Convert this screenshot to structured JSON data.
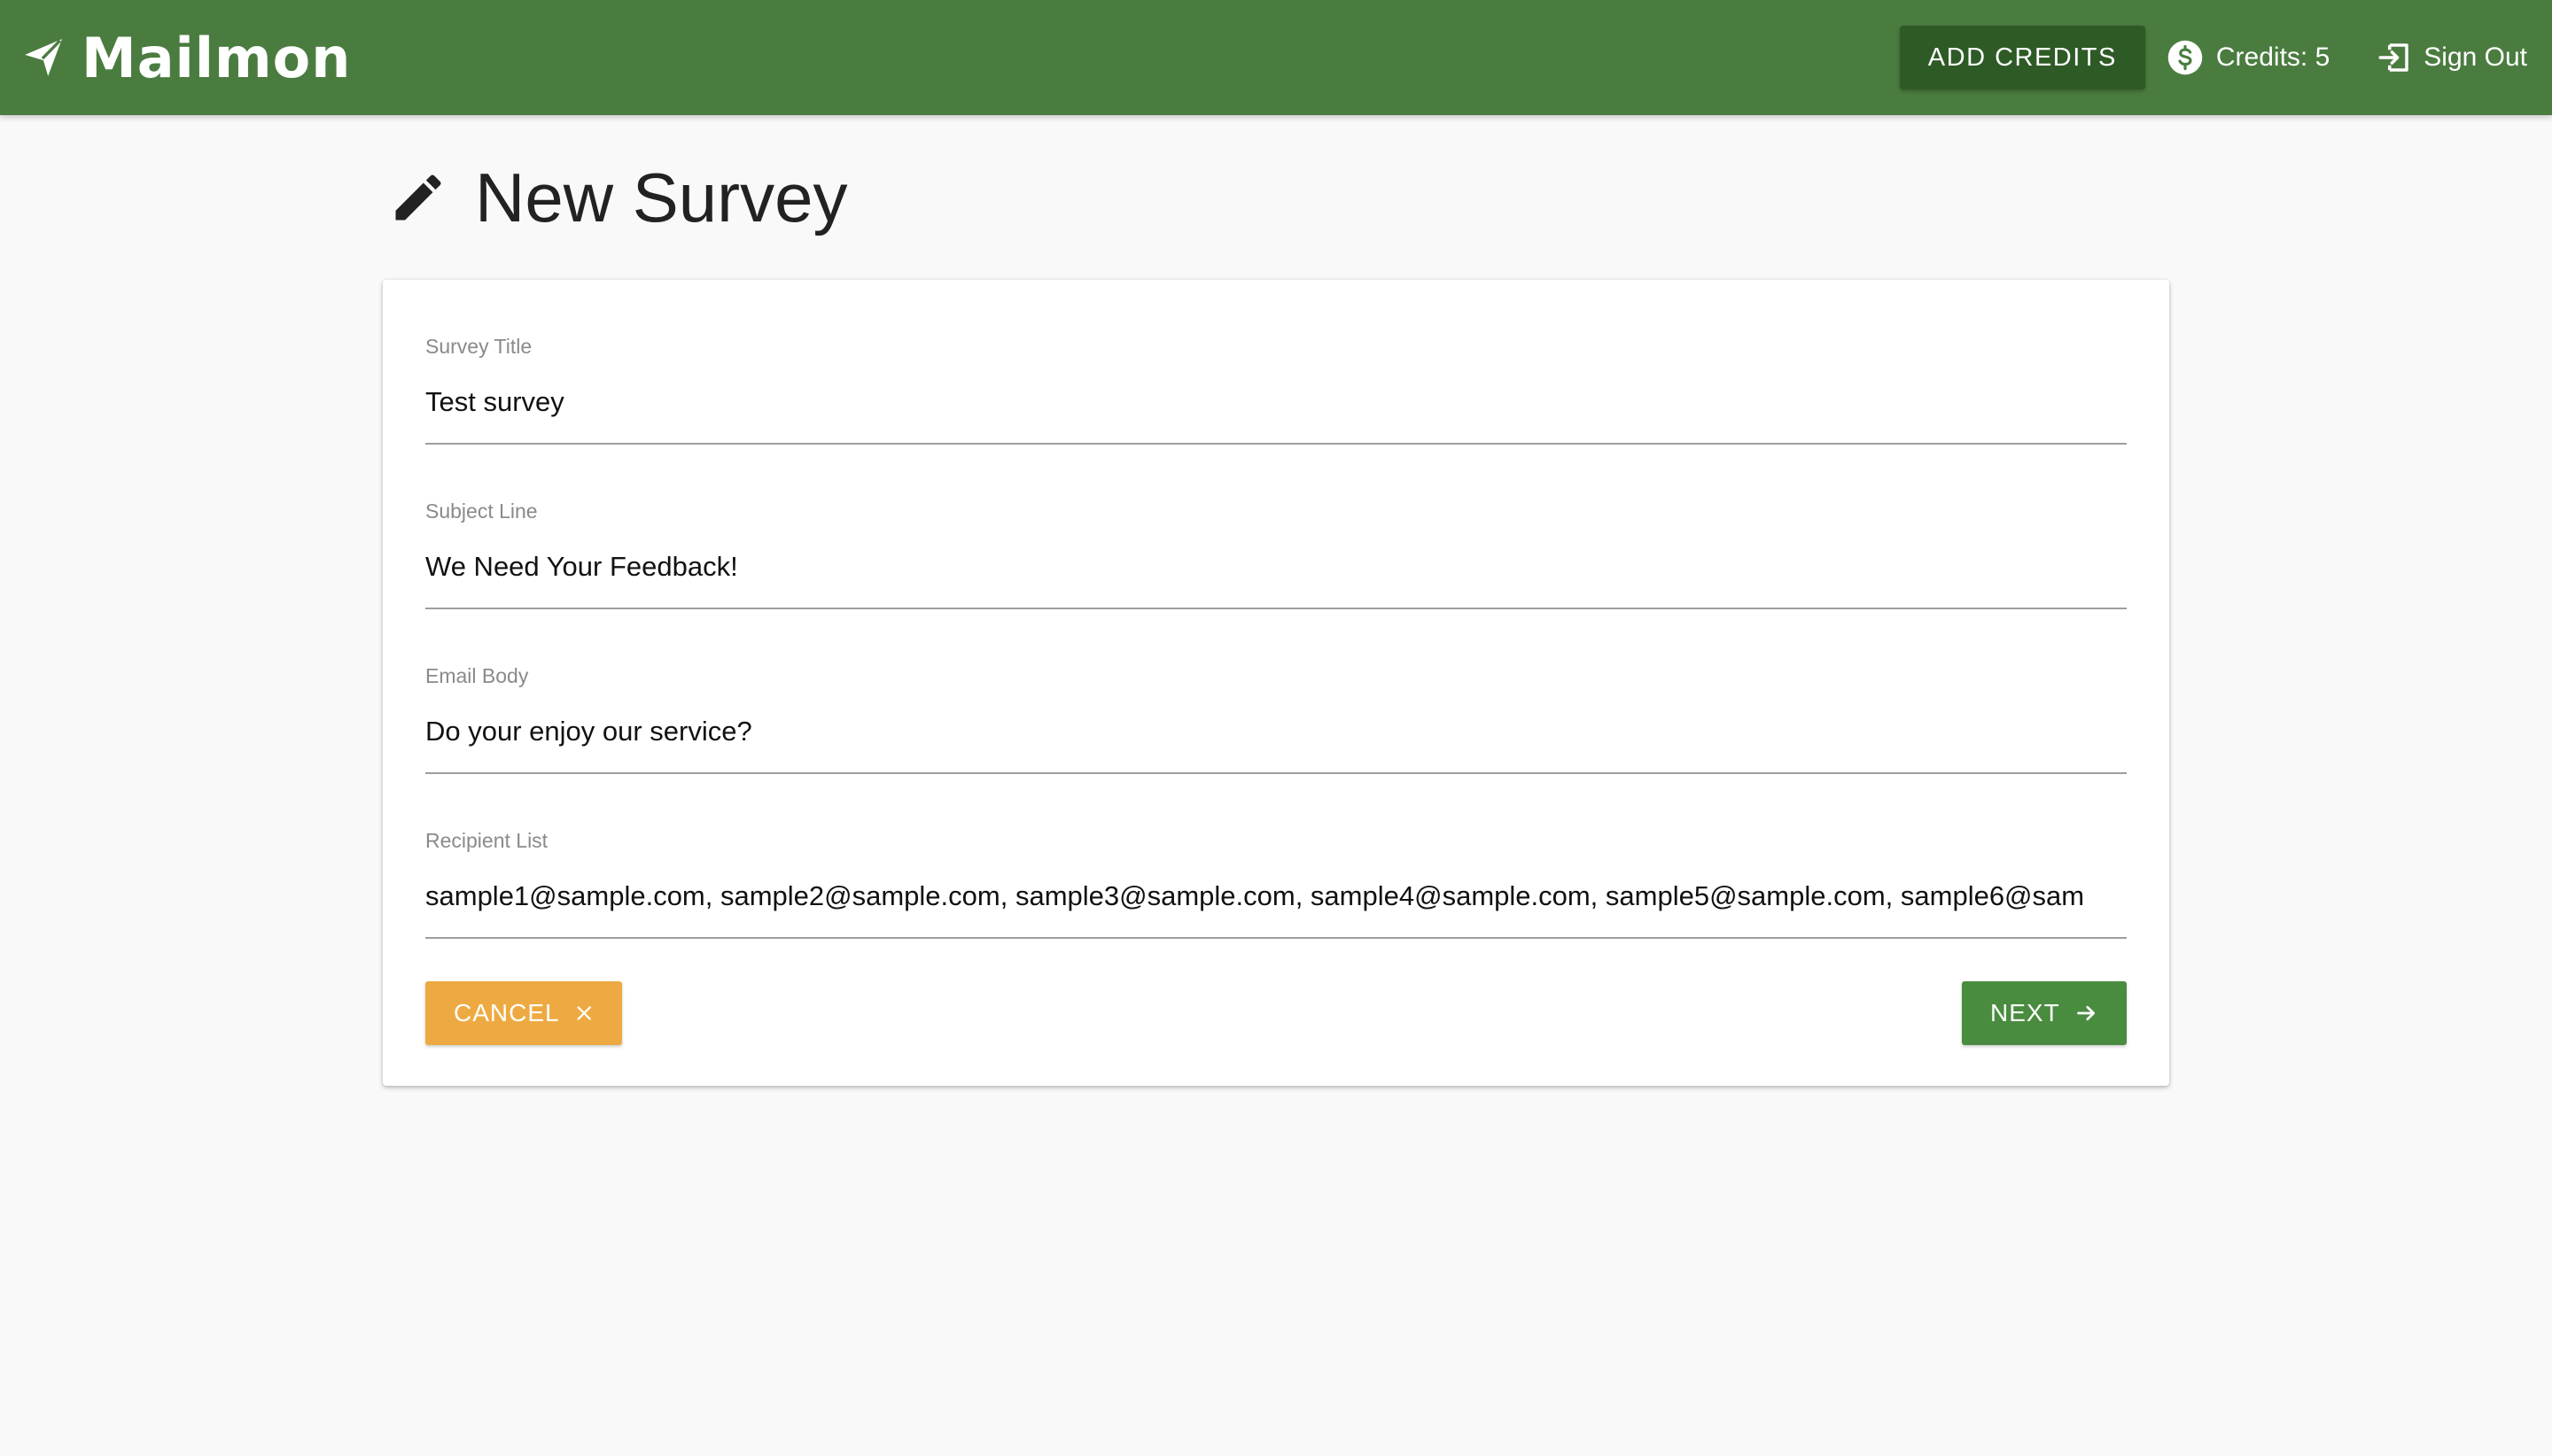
{
  "navbar": {
    "brand": "Mailmon",
    "brand_icon": "paper-plane-icon",
    "add_credits_label": "ADD CREDITS",
    "credits_label": "Credits: 5",
    "credits_icon": "dollar-circle-icon",
    "signout_label": "Sign Out",
    "signout_icon": "sign-out-icon",
    "color": "#4a7c3f"
  },
  "page": {
    "title": "New Survey",
    "title_icon": "pencil-icon"
  },
  "form": {
    "fields": [
      {
        "label": "Survey Title",
        "value": "Test survey"
      },
      {
        "label": "Subject Line",
        "value": "We Need Your Feedback!"
      },
      {
        "label": "Email Body",
        "value": "Do your enjoy our service?"
      },
      {
        "label": "Recipient List",
        "value": "sample1@sample.com, sample2@sample.com, sample3@sample.com, sample4@sample.com, sample5@sample.com, sample6@sam"
      }
    ],
    "cancel_label": "CANCEL",
    "cancel_icon": "close-icon",
    "cancel_color": "#eeaa42",
    "next_label": "NEXT",
    "next_icon": "arrow-right-icon",
    "next_color": "#4a8c3f"
  }
}
